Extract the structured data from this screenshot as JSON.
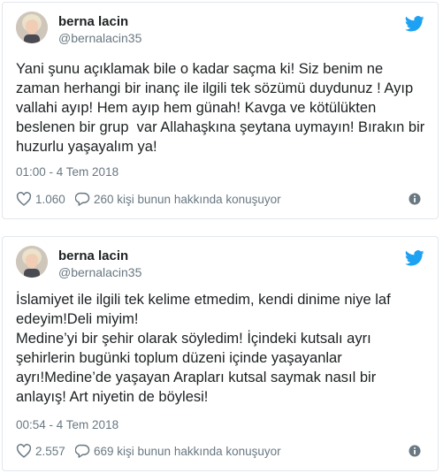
{
  "tweets": [
    {
      "name": "berna lacin",
      "handle": "@bernalacin35",
      "text": "Yani şunu açıklamak bile o kadar saçma ki! Siz benim ne zaman herhangi bir inanç ile ilgili tek sözümü duydunuz ! Ayıp vallahi ayıp! Hem ayıp hem günah! Kavga ve kötülükten beslenen bir grup  var Allahaşkına şeytana uymayın! Bırakın bir huzurlu yaşayalım ya!",
      "time": "01:00 - 4 Tem 2018",
      "likes": "1.060",
      "replies": "260 kişi bunun hakkında konuşuyor"
    },
    {
      "name": "berna lacin",
      "handle": "@bernalacin35",
      "text": "İslamiyet ile ilgili tek kelime etmedim, kendi dinime niye laf edeyim!Deli miyim!\nMedine’yi bir şehir olarak söyledim! İçindeki kutsalı ayrı şehirlerin bugünki toplum düzeni içinde yaşayanlar ayrı!Medine’de yaşayan Arapları kutsal saymak nasıl bir anlayış! Art niyetin de böylesi!",
      "time": "00:54 - 4 Tem 2018",
      "likes": "2.557",
      "replies": "669 kişi bunun hakkında konuşuyor"
    }
  ],
  "icons": {
    "logo": "twitter-bird-icon",
    "like": "heart-icon",
    "reply": "speech-bubble-icon",
    "more": "info-icon"
  },
  "colors": {
    "twitter_blue": "#1da1f2",
    "meta_gray": "#697882",
    "border": "#e1e8ed"
  }
}
